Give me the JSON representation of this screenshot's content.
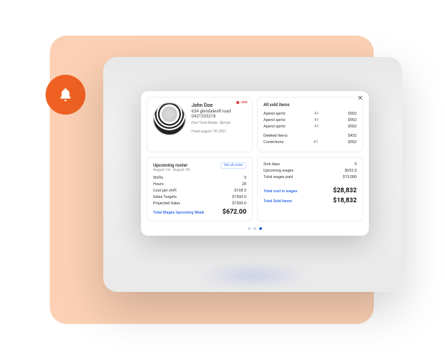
{
  "badge": "uber",
  "profile": {
    "name": "John Doe",
    "address": "634 glendalevill road",
    "phone": "0421255218",
    "role": "Part Time Waiter",
    "rate": "$64 ph",
    "hired": "Hired august 7th 2021"
  },
  "sold": {
    "title": "All sold items",
    "items": [
      {
        "name": "Aperol spritz",
        "qty": "41",
        "amt": "$902"
      },
      {
        "name": "Aperol spritz",
        "qty": "41",
        "amt": "$902"
      },
      {
        "name": "Aperol spritz",
        "qty": "41",
        "amt": "$902"
      }
    ],
    "deleted": {
      "label": "Deleted Items",
      "amt": "$432"
    },
    "corrections": {
      "label": "Corrections",
      "qty": "41",
      "amt": "$902"
    }
  },
  "roster": {
    "title": "Upcoming roster",
    "range": "August 1st - August 7th",
    "see_all": "See all roster",
    "rows": [
      {
        "label": "Shifts",
        "value": "5"
      },
      {
        "label": "Hours",
        "value": "28"
      },
      {
        "label": "Cost per shift",
        "value": "$168.5"
      },
      {
        "label": "Sales Targets",
        "value": "$1500.0"
      },
      {
        "label": "Projected Sales",
        "value": "$1500.0"
      }
    ],
    "total": {
      "label": "Total Wages Upcoming Week",
      "value": "$672.00"
    }
  },
  "summary": {
    "rows": [
      {
        "label": "Sick days",
        "value": "5"
      },
      {
        "label": "Upcoming wages",
        "value": "$652.0"
      },
      {
        "label": "Total wages paid",
        "value": "$15,000"
      }
    ],
    "totals": [
      {
        "label": "Total cost in wages",
        "value": "$28,832"
      },
      {
        "label": "Total Sold Items",
        "value": "$18,832"
      }
    ]
  }
}
